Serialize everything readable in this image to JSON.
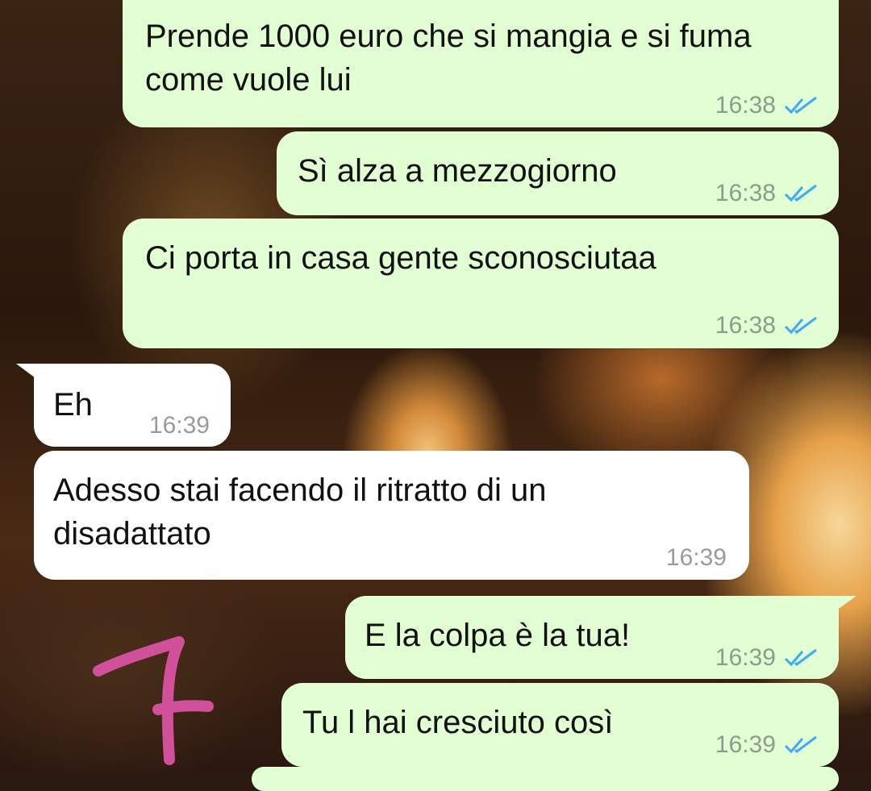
{
  "messages": [
    {
      "direction": "out",
      "text": "Prende 1000 euro che si mangia e si fuma come vuole lui",
      "time": "16:38",
      "status": "read"
    },
    {
      "direction": "out",
      "text": "Sì alza a mezzogiorno",
      "time": "16:38",
      "status": "read"
    },
    {
      "direction": "out",
      "text": "Ci porta in casa gente sconosciutaa",
      "time": "16:38",
      "status": "read"
    },
    {
      "direction": "in",
      "text": "Eh",
      "time": "16:39"
    },
    {
      "direction": "in",
      "text": "Adesso stai facendo il ritratto di un disadattato",
      "time": "16:39"
    },
    {
      "direction": "out",
      "text": "E la colpa è la tua!",
      "time": "16:39",
      "status": "read"
    },
    {
      "direction": "out",
      "text": "Tu l hai cresciuto così",
      "time": "16:39",
      "status": "read"
    }
  ],
  "annotation": {
    "text": "7",
    "color": "#d0509a"
  },
  "colors": {
    "outgoing_bubble": "#e2ffd4",
    "incoming_bubble": "#ffffff",
    "read_tick": "#3fa9f5",
    "timestamp": "#8d9c8a"
  },
  "icons": {
    "status_read": "double-check-icon"
  }
}
